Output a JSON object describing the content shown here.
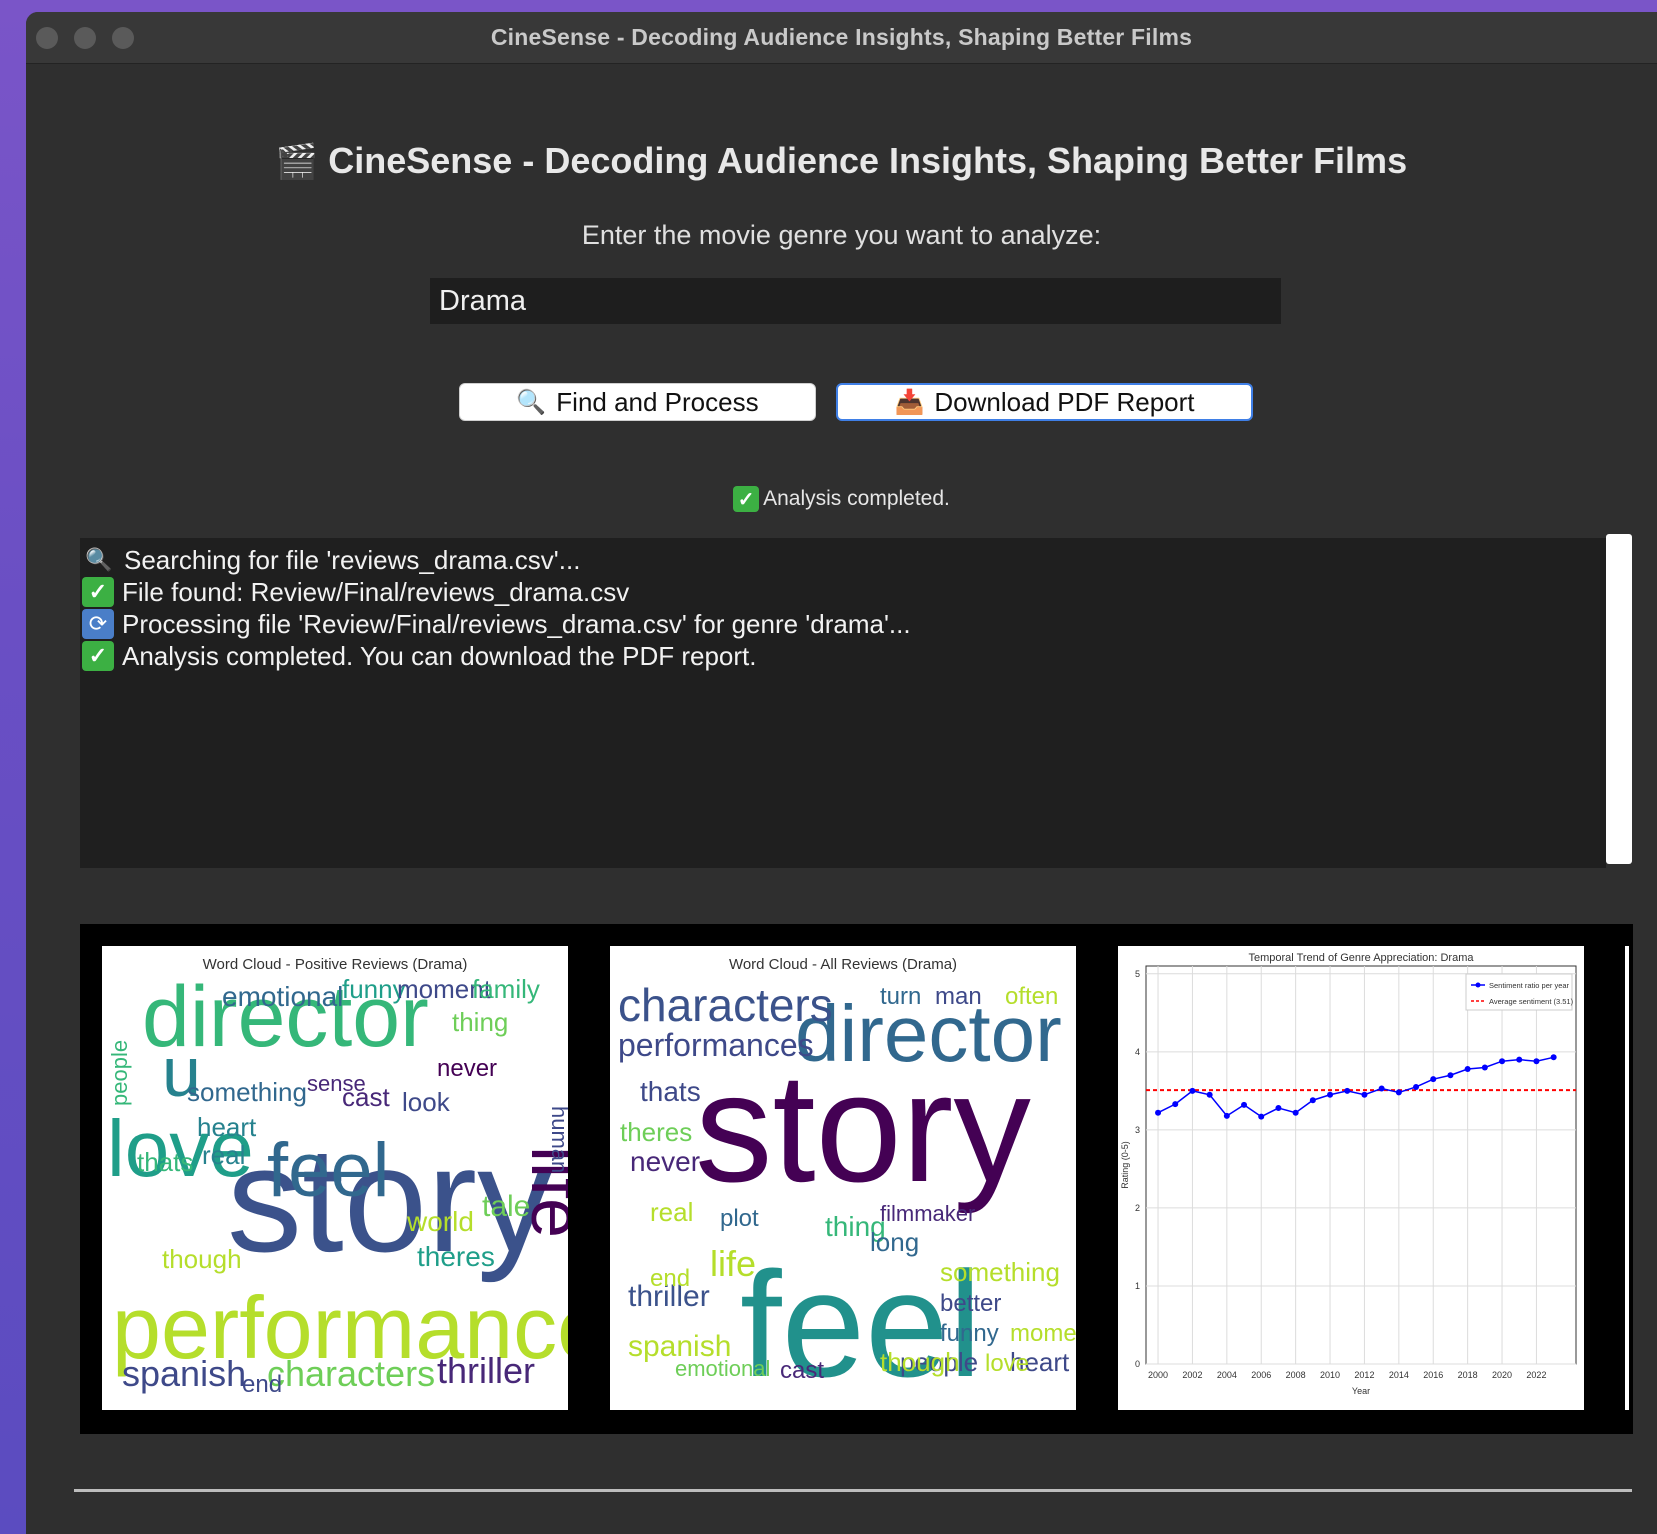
{
  "window": {
    "title": "CineSense - Decoding Audience Insights, Shaping Better Films"
  },
  "header": {
    "icon": "clapperboard-icon",
    "title": "CineSense - Decoding Audience Insights, Shaping Better Films"
  },
  "form": {
    "prompt": "Enter the movie genre you want to analyze:",
    "genre_value": "Drama"
  },
  "buttons": {
    "find_label": "Find and Process",
    "find_icon": "magnifier-icon",
    "download_label": "Download PDF Report",
    "download_icon": "inbox-tray-icon"
  },
  "status": {
    "text": "Analysis completed."
  },
  "log": {
    "lines": [
      {
        "icon": "magnifier-icon",
        "text": "Searching for file 'reviews_drama.csv'..."
      },
      {
        "icon": "check-icon",
        "text": "File found: Review/Final/reviews_drama.csv"
      },
      {
        "icon": "sync-icon",
        "text": "Processing file 'Review/Final/reviews_drama.csv' for genre 'drama'..."
      },
      {
        "icon": "check-icon",
        "text": "Analysis completed. You can download the PDF report."
      }
    ]
  },
  "gallery": {
    "wordcloud_positive": {
      "title": "Word Cloud - Positive Reviews (Drama)",
      "words": [
        {
          "text": "story",
          "weight": 1.0,
          "color": "#3b528b"
        },
        {
          "text": "performances",
          "weight": 0.85,
          "color": "#b5de2b"
        },
        {
          "text": "director",
          "weight": 0.75,
          "color": "#35b779"
        },
        {
          "text": "love",
          "weight": 0.7,
          "color": "#1f9e89"
        },
        {
          "text": "life",
          "weight": 0.6,
          "color": "#440154"
        },
        {
          "text": "feel",
          "weight": 0.6,
          "color": "#31688e"
        },
        {
          "text": "u",
          "weight": 0.5,
          "color": "#26828e"
        },
        {
          "text": "spanish",
          "weight": 0.35,
          "color": "#3e4989"
        },
        {
          "text": "characters",
          "weight": 0.35,
          "color": "#6ece58"
        },
        {
          "text": "thriller",
          "weight": 0.35,
          "color": "#482878"
        },
        {
          "text": "emotional",
          "weight": 0.3,
          "color": "#31688e"
        },
        {
          "text": "funny",
          "weight": 0.28,
          "color": "#1f9e89"
        },
        {
          "text": "moment",
          "weight": 0.28,
          "color": "#3e4989"
        },
        {
          "text": "family",
          "weight": 0.28,
          "color": "#35b779"
        },
        {
          "text": "something",
          "weight": 0.28,
          "color": "#31688e"
        },
        {
          "text": "cast",
          "weight": 0.28,
          "color": "#482878"
        },
        {
          "text": "look",
          "weight": 0.28,
          "color": "#3e4989"
        },
        {
          "text": "world",
          "weight": 0.28,
          "color": "#b5de2b"
        },
        {
          "text": "tale",
          "weight": 0.28,
          "color": "#6ece58"
        },
        {
          "text": "theres",
          "weight": 0.28,
          "color": "#1f9e89"
        },
        {
          "text": "heart",
          "weight": 0.26,
          "color": "#26828e"
        },
        {
          "text": "thats",
          "weight": 0.26,
          "color": "#35b779"
        },
        {
          "text": "real",
          "weight": 0.26,
          "color": "#26828e"
        },
        {
          "text": "though",
          "weight": 0.26,
          "color": "#b5de2b"
        },
        {
          "text": "never",
          "weight": 0.24,
          "color": "#440154"
        },
        {
          "text": "thing",
          "weight": 0.24,
          "color": "#6ece58"
        },
        {
          "text": "sense",
          "weight": 0.22,
          "color": "#482878"
        },
        {
          "text": "people",
          "weight": 0.22,
          "color": "#35b779"
        },
        {
          "text": "human",
          "weight": 0.22,
          "color": "#3e4989"
        },
        {
          "text": "end",
          "weight": 0.22,
          "color": "#3e4989"
        }
      ]
    },
    "wordcloud_all": {
      "title": "Word Cloud - All Reviews (Drama)",
      "words": [
        {
          "text": "story",
          "weight": 1.0,
          "color": "#440154"
        },
        {
          "text": "feel",
          "weight": 0.95,
          "color": "#21918c"
        },
        {
          "text": "director",
          "weight": 0.75,
          "color": "#31688e"
        },
        {
          "text": "characters",
          "weight": 0.45,
          "color": "#3b528b"
        },
        {
          "text": "performances",
          "weight": 0.35,
          "color": "#3e4989"
        },
        {
          "text": "thriller",
          "weight": 0.33,
          "color": "#3b528b"
        },
        {
          "text": "life",
          "weight": 0.33,
          "color": "#b5de2b"
        },
        {
          "text": "spanish",
          "weight": 0.3,
          "color": "#b5de2b"
        },
        {
          "text": "thats",
          "weight": 0.28,
          "color": "#3e4989"
        },
        {
          "text": "theres",
          "weight": 0.28,
          "color": "#6ece58"
        },
        {
          "text": "never",
          "weight": 0.28,
          "color": "#482878"
        },
        {
          "text": "real",
          "weight": 0.28,
          "color": "#b5de2b"
        },
        {
          "text": "thing",
          "weight": 0.28,
          "color": "#35b779"
        },
        {
          "text": "long",
          "weight": 0.28,
          "color": "#31688e"
        },
        {
          "text": "filmmaker",
          "weight": 0.26,
          "color": "#482878"
        },
        {
          "text": "something",
          "weight": 0.26,
          "color": "#b5de2b"
        },
        {
          "text": "better",
          "weight": 0.26,
          "color": "#3e4989"
        },
        {
          "text": "funny",
          "weight": 0.26,
          "color": "#31688e"
        },
        {
          "text": "moment",
          "weight": 0.26,
          "color": "#b5de2b"
        },
        {
          "text": "heart",
          "weight": 0.26,
          "color": "#3e4989"
        },
        {
          "text": "love",
          "weight": 0.26,
          "color": "#b5de2b"
        },
        {
          "text": "people",
          "weight": 0.26,
          "color": "#3e4989"
        },
        {
          "text": "though",
          "weight": 0.26,
          "color": "#b5de2b"
        },
        {
          "text": "cast",
          "weight": 0.26,
          "color": "#482878"
        },
        {
          "text": "emotional",
          "weight": 0.24,
          "color": "#6ece58"
        },
        {
          "text": "turn",
          "weight": 0.24,
          "color": "#31688e"
        },
        {
          "text": "man",
          "weight": 0.24,
          "color": "#3e4989"
        },
        {
          "text": "often",
          "weight": 0.24,
          "color": "#b5de2b"
        },
        {
          "text": "plot",
          "weight": 0.24,
          "color": "#31688e"
        },
        {
          "text": "end",
          "weight": 0.24,
          "color": "#b5de2b"
        }
      ]
    },
    "trend_chart": {
      "title": "Temporal Trend of Genre Appreciation: Drama"
    }
  },
  "chart_data": {
    "type": "line",
    "title": "Temporal Trend of Genre Appreciation: Drama",
    "xlabel": "Year",
    "ylabel": "Rating (0-5)",
    "xlim": [
      1999.3,
      2024.3
    ],
    "ylim": [
      0,
      5.1
    ],
    "x_ticks": [
      "2000",
      "2002",
      "2004",
      "2006",
      "2008",
      "2010",
      "2012",
      "2014",
      "2016",
      "2018",
      "2020",
      "2022"
    ],
    "y_ticks": [
      "0",
      "1",
      "2",
      "3",
      "4",
      "5"
    ],
    "grid": true,
    "legend_position": "top-right",
    "series": [
      {
        "name": "Sentiment ratio per year",
        "color": "#0000ff",
        "x": [
          2000,
          2001,
          2002,
          2003,
          2004,
          2005,
          2006,
          2007,
          2008,
          2009,
          2010,
          2011,
          2012,
          2013,
          2014,
          2015,
          2016,
          2017,
          2018,
          2019,
          2020,
          2021,
          2022,
          2023
        ],
        "values": [
          3.22,
          3.33,
          3.5,
          3.45,
          3.18,
          3.32,
          3.17,
          3.28,
          3.22,
          3.38,
          3.45,
          3.5,
          3.45,
          3.53,
          3.48,
          3.55,
          3.65,
          3.7,
          3.78,
          3.8,
          3.88,
          3.9,
          3.88,
          3.93
        ]
      },
      {
        "name": "Average sentiment (3.51)",
        "color": "#ff0000",
        "style": "dashed",
        "constant": 3.51
      }
    ]
  }
}
